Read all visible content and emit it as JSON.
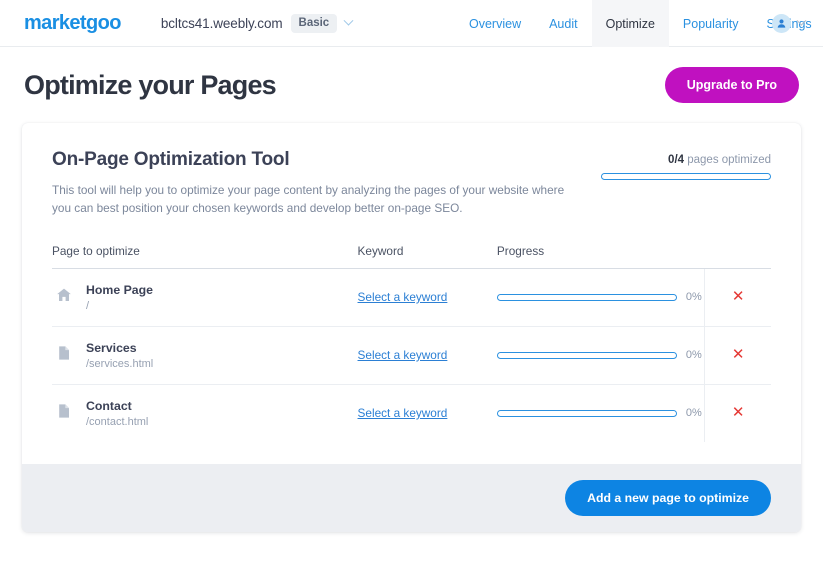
{
  "header": {
    "logo": "marketgoo",
    "site_name": "bcltcs41.weebly.com",
    "plan_badge": "Basic",
    "nav": [
      {
        "label": "Overview",
        "active": false
      },
      {
        "label": "Audit",
        "active": false
      },
      {
        "label": "Optimize",
        "active": true
      },
      {
        "label": "Popularity",
        "active": false
      },
      {
        "label": "Settings",
        "active": false
      }
    ]
  },
  "title_bar": {
    "page_title": "Optimize your Pages",
    "upgrade_label": "Upgrade to Pro"
  },
  "tool": {
    "title": "On-Page Optimization Tool",
    "description": "This tool will help you to optimize your page content by analyzing the pages of your website where you can best position your chosen keywords and develop better on-page SEO.",
    "optimized_count": "0/4",
    "optimized_suffix": " pages optimized",
    "optimized_percent": 0
  },
  "table": {
    "headers": {
      "page": "Page to optimize",
      "keyword": "Keyword",
      "progress": "Progress"
    },
    "rows": [
      {
        "icon": "home-icon",
        "name": "Home Page",
        "path": "/",
        "keyword_link": "Select a keyword",
        "progress_label": "0%",
        "progress_value": 0,
        "delete_glyph": "✕"
      },
      {
        "icon": "document-icon",
        "name": "Services",
        "path": "/services.html",
        "keyword_link": "Select a keyword",
        "progress_label": "0%",
        "progress_value": 0,
        "delete_glyph": "✕"
      },
      {
        "icon": "document-icon",
        "name": "Contact",
        "path": "/contact.html",
        "keyword_link": "Select a keyword",
        "progress_label": "0%",
        "progress_value": 0,
        "delete_glyph": "✕"
      }
    ]
  },
  "footer": {
    "add_page_label": "Add a new page to optimize"
  },
  "colors": {
    "brand_blue": "#1a8fe3",
    "link_blue": "#2b7fd4",
    "upgrade_magenta": "#c011c0",
    "add_button_blue": "#0d84e3",
    "delete_red": "#e53935",
    "text_dark": "#2f3542",
    "text_muted": "#7c879b"
  }
}
